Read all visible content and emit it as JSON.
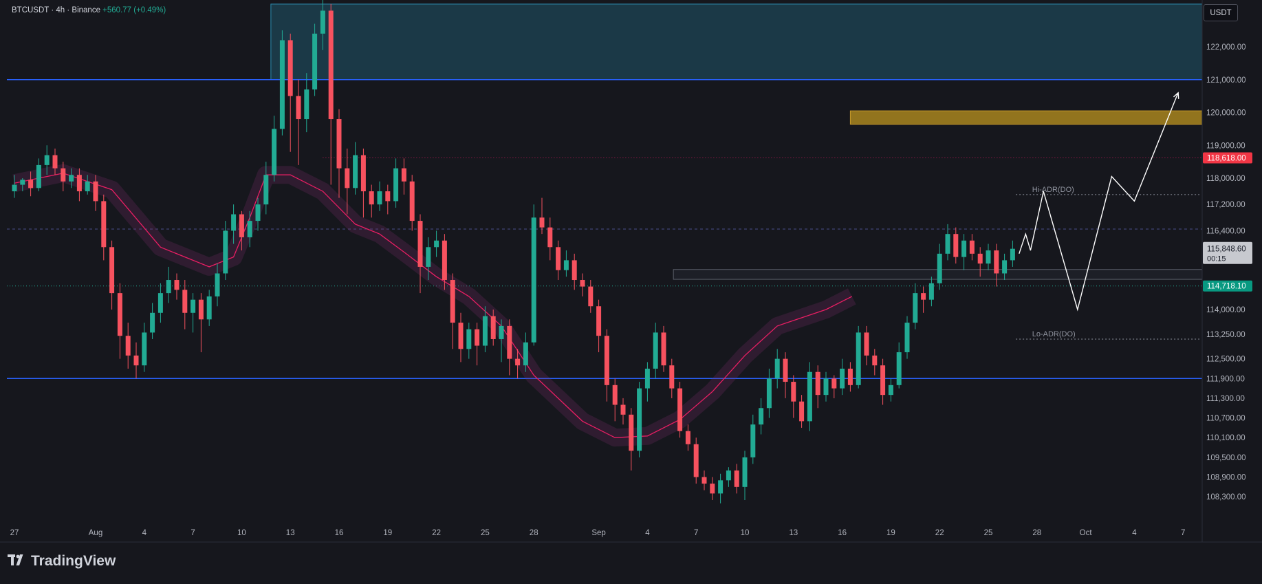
{
  "header": {
    "symbol": "BTCUSDT",
    "sep1": "·",
    "interval": "4h",
    "sep2": "·",
    "exchange": "Binance",
    "change": "+560.77 (+0.49%)",
    "currency": "USDT"
  },
  "brand": {
    "name": "TradingView",
    "icon": "tradingview-logo-icon"
  },
  "colors": {
    "background": "#16171d",
    "up": "#22ab94",
    "down": "#f7525f",
    "ema": "#e91e63",
    "level_line": "#2962ff",
    "target_zone": "#1c3d4d",
    "gold_zone": "#a07e1f",
    "resistance_tag": "#f23645",
    "price_tag": "#089981"
  },
  "chart_data": {
    "type": "candlestick",
    "title": "",
    "xlabel": "",
    "ylabel": "",
    "ylim": [
      107900,
      123600
    ],
    "xlim": [
      "Jul 27",
      "Oct 8"
    ],
    "grid": false,
    "x_ticks": [
      "27",
      "Aug",
      "4",
      "7",
      "10",
      "13",
      "16",
      "19",
      "22",
      "25",
      "28",
      "Sep",
      "4",
      "7",
      "10",
      "13",
      "16",
      "19",
      "22",
      "25",
      "28",
      "Oct",
      "4",
      "7"
    ],
    "y_ticks": [
      "122,000.00",
      "121,000.00",
      "120,000.00",
      "119,000.00",
      "118,000.00",
      "117,200.00",
      "116,400.00",
      "114,000.00",
      "113,250.00",
      "112,500.00",
      "111,900.00",
      "111,300.00",
      "110,700.00",
      "110,100.00",
      "109,500.00",
      "108,900.00",
      "108,300.00"
    ],
    "price_labels": {
      "resistance": "118,618.00",
      "last": "115,848.60",
      "countdown": "00:15",
      "support": "114,718.10"
    },
    "annotations": {
      "hi_adr": "Hi-ADR(DO)",
      "lo_adr": "Lo-ADR(DO)"
    },
    "levels": {
      "upper_line": 121000,
      "lower_line": 111900,
      "resistance_dotted": 118618,
      "dashed": 116450,
      "support_dotted": 114718,
      "hi_adr": 117500,
      "lo_adr": 113100
    },
    "zones": [
      {
        "name": "target",
        "from": 121000,
        "to": 123300,
        "start_day": 15.8,
        "end_day": 85
      },
      {
        "name": "gold",
        "from": 119640,
        "to": 120050,
        "start_day": 51.5,
        "end_day": 85
      },
      {
        "name": "consolidation",
        "from": 114920,
        "to": 115220,
        "start_day": 40.6,
        "end_day": 77.5
      }
    ],
    "projection_path": [
      [
        61.9,
        115700
      ],
      [
        62.3,
        116300
      ],
      [
        62.6,
        115800
      ],
      [
        63.4,
        117600
      ],
      [
        65.5,
        114000
      ],
      [
        67.6,
        118050
      ],
      [
        69.0,
        117300
      ],
      [
        71.7,
        120600
      ]
    ],
    "ema": [
      [
        0,
        117850
      ],
      [
        3,
        118150
      ],
      [
        6,
        117650
      ],
      [
        9,
        115900
      ],
      [
        12,
        115300
      ],
      [
        13.5,
        115600
      ],
      [
        14.5,
        116800
      ],
      [
        15.5,
        118100
      ],
      [
        17,
        118100
      ],
      [
        19,
        117600
      ],
      [
        21,
        116600
      ],
      [
        22.5,
        116300
      ],
      [
        24,
        115750
      ],
      [
        26,
        115000
      ],
      [
        28,
        114400
      ],
      [
        30,
        113500
      ],
      [
        32,
        112000
      ],
      [
        35,
        110600
      ],
      [
        37,
        110100
      ],
      [
        39,
        110150
      ],
      [
        41,
        110650
      ],
      [
        43,
        111500
      ],
      [
        45,
        112600
      ],
      [
        47,
        113500
      ],
      [
        50,
        114000
      ],
      [
        51.6,
        114400
      ]
    ],
    "candles": [
      [
        0,
        117600,
        117800,
        117400,
        118100
      ],
      [
        0.5,
        117800,
        117950,
        117600,
        118000
      ],
      [
        1,
        117950,
        117700,
        117450,
        118200
      ],
      [
        1.5,
        117700,
        118400,
        117600,
        118600
      ],
      [
        2,
        118400,
        118700,
        118100,
        119000
      ],
      [
        2.5,
        118700,
        118300,
        118100,
        118900
      ],
      [
        3,
        118300,
        117900,
        117600,
        118500
      ],
      [
        3.5,
        117900,
        118100,
        117700,
        118300
      ],
      [
        4,
        118100,
        117600,
        117300,
        118300
      ],
      [
        4.5,
        117600,
        117900,
        117500,
        118100
      ],
      [
        5,
        117900,
        117300,
        117000,
        118100
      ],
      [
        5.5,
        117300,
        115900,
        115500,
        117500
      ],
      [
        6,
        115900,
        114500,
        114000,
        116100
      ],
      [
        6.5,
        114500,
        113200,
        112500,
        114800
      ],
      [
        7,
        113200,
        112600,
        112200,
        113600
      ],
      [
        7.5,
        112600,
        112300,
        111900,
        113000
      ],
      [
        8,
        112300,
        113300,
        112100,
        113600
      ],
      [
        8.5,
        113300,
        113900,
        113100,
        114200
      ],
      [
        9,
        113900,
        114500,
        113600,
        114800
      ],
      [
        9.5,
        114500,
        114900,
        114200,
        115300
      ],
      [
        10,
        114900,
        114600,
        114300,
        115100
      ],
      [
        10.5,
        114600,
        113900,
        113400,
        114900
      ],
      [
        11,
        113900,
        114300,
        113300,
        114500
      ],
      [
        11.5,
        114300,
        113700,
        112700,
        114500
      ],
      [
        12,
        113700,
        114400,
        113500,
        114600
      ],
      [
        12.5,
        114400,
        115100,
        114100,
        115400
      ],
      [
        13,
        115100,
        116400,
        114900,
        116700
      ],
      [
        13.5,
        116400,
        116900,
        116000,
        117200
      ],
      [
        14,
        116900,
        116200,
        115800,
        117000
      ],
      [
        14.5,
        116200,
        116700,
        115900,
        117000
      ],
      [
        15,
        116700,
        117200,
        116400,
        117400
      ],
      [
        15.5,
        117200,
        118100,
        116900,
        118500
      ],
      [
        16,
        118100,
        119500,
        117900,
        119900
      ],
      [
        16.5,
        119500,
        122200,
        119300,
        122500
      ],
      [
        17,
        122200,
        120500,
        118800,
        122400
      ],
      [
        17.5,
        120500,
        119800,
        118400,
        121000
      ],
      [
        18,
        119800,
        120700,
        119400,
        121200
      ],
      [
        18.5,
        120700,
        122400,
        120500,
        122700
      ],
      [
        19,
        122400,
        123100,
        121900,
        123500
      ],
      [
        19.5,
        123100,
        119800,
        117800,
        123300
      ],
      [
        20,
        119800,
        118300,
        117400,
        120100
      ],
      [
        20.5,
        118300,
        117700,
        116900,
        118900
      ],
      [
        21,
        117700,
        118700,
        117500,
        119100
      ],
      [
        21.5,
        118700,
        117600,
        116800,
        118900
      ],
      [
        22,
        117600,
        117200,
        116800,
        117800
      ],
      [
        22.5,
        117200,
        117600,
        117000,
        117900
      ],
      [
        23,
        117600,
        117300,
        116900,
        117800
      ],
      [
        23.5,
        117300,
        118300,
        117100,
        118600
      ],
      [
        24,
        118300,
        117900,
        117500,
        118600
      ],
      [
        24.5,
        117900,
        116700,
        116400,
        118100
      ],
      [
        25,
        116700,
        115300,
        114500,
        116900
      ],
      [
        25.5,
        115300,
        115900,
        114900,
        116200
      ],
      [
        26,
        115900,
        116100,
        115600,
        116400
      ],
      [
        26.5,
        116100,
        114900,
        114600,
        116300
      ],
      [
        27,
        114900,
        113600,
        112800,
        115100
      ],
      [
        27.5,
        113600,
        112800,
        112400,
        113900
      ],
      [
        28,
        112800,
        113400,
        112500,
        113600
      ],
      [
        28.5,
        113400,
        112900,
        112300,
        113600
      ],
      [
        29,
        112900,
        113800,
        112700,
        114100
      ],
      [
        29.5,
        113800,
        113100,
        112900,
        114000
      ],
      [
        30,
        113100,
        113500,
        112400,
        113700
      ],
      [
        30.5,
        113500,
        112500,
        112000,
        113700
      ],
      [
        31,
        112500,
        112300,
        111900,
        112800
      ],
      [
        31.5,
        112300,
        113000,
        112100,
        113300
      ],
      [
        32,
        113000,
        116800,
        112900,
        117200
      ],
      [
        32.5,
        116800,
        116500,
        116300,
        117400
      ],
      [
        33,
        116500,
        115900,
        115500,
        116800
      ],
      [
        33.5,
        115900,
        115200,
        114900,
        116100
      ],
      [
        34,
        115200,
        115500,
        115000,
        115800
      ],
      [
        34.5,
        115500,
        114900,
        114600,
        115700
      ],
      [
        35,
        114900,
        114700,
        114400,
        115100
      ],
      [
        35.5,
        114700,
        114100,
        113900,
        114900
      ],
      [
        36,
        114100,
        113200,
        112700,
        114300
      ],
      [
        36.5,
        113200,
        111700,
        111200,
        113400
      ],
      [
        37,
        111700,
        111100,
        110600,
        111900
      ],
      [
        37.5,
        111100,
        110800,
        110500,
        111300
      ],
      [
        38,
        110800,
        109700,
        109100,
        111000
      ],
      [
        38.5,
        109700,
        111600,
        109500,
        111800
      ],
      [
        39,
        111600,
        112200,
        111200,
        112400
      ],
      [
        39.5,
        112200,
        113300,
        111900,
        113600
      ],
      [
        40,
        113300,
        112300,
        112100,
        113500
      ],
      [
        40.5,
        112300,
        111600,
        111300,
        112500
      ],
      [
        41,
        111600,
        110300,
        110100,
        111800
      ],
      [
        41.5,
        110300,
        109900,
        109700,
        110500
      ],
      [
        42,
        109900,
        108900,
        108700,
        110100
      ],
      [
        42.5,
        108900,
        108700,
        108500,
        109100
      ],
      [
        43,
        108700,
        108400,
        108200,
        108900
      ],
      [
        43.5,
        108400,
        108800,
        108100,
        109000
      ],
      [
        44,
        108800,
        109100,
        108600,
        109200
      ],
      [
        44.5,
        109100,
        108600,
        108400,
        109300
      ],
      [
        45,
        108600,
        109500,
        108200,
        109700
      ],
      [
        45.5,
        109500,
        110500,
        109300,
        110800
      ],
      [
        46,
        110500,
        111000,
        110200,
        111300
      ],
      [
        46.5,
        111000,
        111900,
        110700,
        112200
      ],
      [
        47,
        111900,
        112500,
        111600,
        112800
      ],
      [
        47.5,
        112500,
        111800,
        111300,
        112700
      ],
      [
        48,
        111800,
        111200,
        110700,
        112000
      ],
      [
        48.5,
        111200,
        110600,
        110400,
        111400
      ],
      [
        49,
        110600,
        112100,
        110300,
        112400
      ],
      [
        49.5,
        112100,
        111400,
        111000,
        112300
      ],
      [
        50,
        111400,
        111900,
        111200,
        112100
      ],
      [
        50.5,
        111900,
        111600,
        111300,
        112000
      ],
      [
        51,
        111600,
        112200,
        111400,
        112500
      ],
      [
        51.5,
        112200,
        111700,
        111500,
        112400
      ],
      [
        52,
        111700,
        113300,
        111600,
        113500
      ],
      [
        52.5,
        113300,
        112600,
        112300,
        113500
      ],
      [
        53,
        112600,
        112300,
        112000,
        112800
      ],
      [
        53.5,
        112300,
        111400,
        111100,
        112500
      ],
      [
        54,
        111400,
        111700,
        111200,
        111900
      ],
      [
        54.5,
        111700,
        112700,
        111600,
        113000
      ],
      [
        55,
        112700,
        113600,
        112500,
        113800
      ],
      [
        55.5,
        113600,
        114500,
        113400,
        114800
      ],
      [
        56,
        114500,
        114300,
        113900,
        114700
      ],
      [
        56.5,
        114300,
        114800,
        114100,
        115000
      ],
      [
        57,
        114800,
        115700,
        114600,
        116000
      ],
      [
        57.5,
        115700,
        116300,
        115500,
        116600
      ],
      [
        58,
        116300,
        115600,
        115400,
        116500
      ],
      [
        58.5,
        115600,
        116100,
        115200,
        116300
      ],
      [
        59,
        116100,
        115700,
        115500,
        116300
      ],
      [
        59.5,
        115700,
        115400,
        115000,
        115900
      ],
      [
        60,
        115400,
        115800,
        115200,
        116000
      ],
      [
        60.5,
        115800,
        115100,
        114700,
        116000
      ],
      [
        61,
        115100,
        115500,
        114900,
        115700
      ],
      [
        61.5,
        115500,
        115850,
        115300,
        116100
      ]
    ]
  }
}
